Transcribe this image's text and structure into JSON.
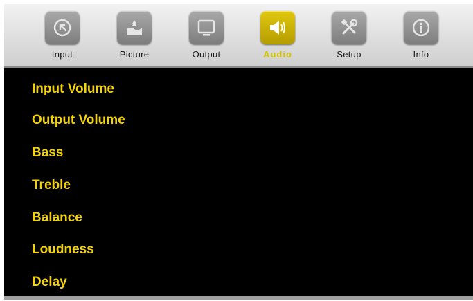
{
  "tabs": [
    {
      "label": "Input",
      "icon": "input-icon"
    },
    {
      "label": "Picture",
      "icon": "picture-icon"
    },
    {
      "label": "Output",
      "icon": "output-icon"
    },
    {
      "label": "Audio",
      "icon": "speaker-icon",
      "active": true
    },
    {
      "label": "Setup",
      "icon": "tools-icon"
    },
    {
      "label": "Info",
      "icon": "info-icon"
    }
  ],
  "menu": {
    "items": [
      {
        "label": "Input Volume"
      },
      {
        "label": "Output Volume"
      },
      {
        "label": "Bass"
      },
      {
        "label": "Treble"
      },
      {
        "label": "Balance"
      },
      {
        "label": "Loudness"
      },
      {
        "label": "Delay"
      }
    ]
  },
  "colors": {
    "menu_text": "#f2d20c",
    "active_tab": "#c9b000",
    "background": "#000000",
    "tabbar": "#dcdcdc"
  }
}
